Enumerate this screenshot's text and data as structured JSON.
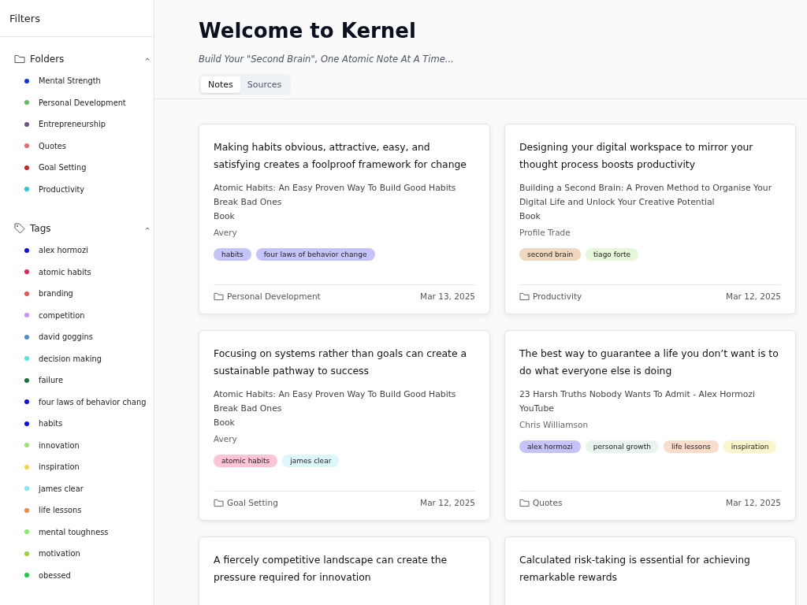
{
  "sidebar": {
    "title": "Filters",
    "sections": [
      {
        "kind": "folder",
        "label": "Folders",
        "expanded": true,
        "items": [
          {
            "label": "Mental Strength",
            "color": "#1030f0"
          },
          {
            "label": "Personal Development",
            "color": "#5cc05c"
          },
          {
            "label": "Entrepreneurship",
            "color": "#6e4f8e"
          },
          {
            "label": "Quotes",
            "color": "#f06868"
          },
          {
            "label": "Goal Setting",
            "color": "#d42020"
          },
          {
            "label": "Productivity",
            "color": "#20c8d8"
          }
        ]
      },
      {
        "kind": "tag",
        "label": "Tags",
        "expanded": true,
        "items": [
          {
            "label": "alex hormozi",
            "color": "#0a10f0"
          },
          {
            "label": "atomic habits",
            "color": "#f01a5a"
          },
          {
            "label": "branding",
            "color": "#f05050"
          },
          {
            "label": "competition",
            "color": "#c890f8"
          },
          {
            "label": "david goggins",
            "color": "#4a90d0"
          },
          {
            "label": "decision making",
            "color": "#50e8e0"
          },
          {
            "label": "failure",
            "color": "#107a3a"
          },
          {
            "label": "four laws of behavior chang",
            "color": "#0a10f0"
          },
          {
            "label": "habits",
            "color": "#0a10f0"
          },
          {
            "label": "innovation",
            "color": "#98e868"
          },
          {
            "label": "inspiration",
            "color": "#f0d840"
          },
          {
            "label": "james clear",
            "color": "#80e8f0"
          },
          {
            "label": "life lessons",
            "color": "#f08838"
          },
          {
            "label": "mental toughness",
            "color": "#80f060"
          },
          {
            "label": "motivation",
            "color": "#a0d030"
          },
          {
            "label": "obessed",
            "color": "#10d040"
          }
        ]
      }
    ]
  },
  "header": {
    "title": "Welcome to Kernel",
    "subtitle": "Build Your \"Second Brain\", One Atomic Note At A Time..."
  },
  "tabs": [
    {
      "label": "Notes",
      "selected": true
    },
    {
      "label": "Sources",
      "selected": false
    }
  ],
  "notes": [
    {
      "title": "Making habits obvious, attractive, easy, and satisfying creates a foolproof framework for change",
      "source": [
        "Atomic Habits: An Easy Proven Way To Build Good Habits Break Bad Ones",
        "Book"
      ],
      "author": "Avery",
      "tags": [
        {
          "label": "habits",
          "color": "#c4c4fb"
        },
        {
          "label": "four laws of behavior change",
          "color": "#c4c4fb"
        }
      ],
      "folder": "Personal Development",
      "date": "Mar 13, 2025"
    },
    {
      "title": "Designing your digital workspace to mirror your thought process boosts productivity",
      "source": [
        "Building a Second Brain: A Proven Method to Organise Your Digital Life and Unlock Your Creative Potential",
        "Book"
      ],
      "author": "Profile Trade",
      "tags": [
        {
          "label": "second brain",
          "color": "#f0d8c0"
        },
        {
          "label": "tiago forte",
          "color": "#e6f6da"
        }
      ],
      "folder": "Productivity",
      "date": "Mar 12, 2025"
    },
    {
      "title": "Focusing on systems rather than goals can create a sustainable pathway to success",
      "source": [
        "Atomic Habits: An Easy Proven Way To Build Good Habits Break Bad Ones",
        "Book"
      ],
      "author": "Avery",
      "tags": [
        {
          "label": "atomic habits",
          "color": "#fcc4d6"
        },
        {
          "label": "james clear",
          "color": "#dcf6fa"
        }
      ],
      "folder": "Goal Setting",
      "date": "Mar 12, 2025"
    },
    {
      "title": "The best way to guarantee a life you don’t want is to do what everyone else is doing",
      "source": [
        "23 Harsh Truths Nobody Wants To Admit - Alex Hormozi",
        "YouTube"
      ],
      "author": "Chris Williamson",
      "tags": [
        {
          "label": "alex hormozi",
          "color": "#c4c4fb"
        },
        {
          "label": "personal growth",
          "color": "#e8f4ee"
        },
        {
          "label": "life lessons",
          "color": "#fadcca"
        },
        {
          "label": "inspiration",
          "color": "#faf6cc"
        }
      ],
      "folder": "Quotes",
      "date": "Mar 12, 2025"
    },
    {
      "title": "A fiercely competitive landscape can create the pressure required for innovation"
    },
    {
      "title": "Calculated risk-taking is essential for achieving remarkable rewards"
    }
  ]
}
